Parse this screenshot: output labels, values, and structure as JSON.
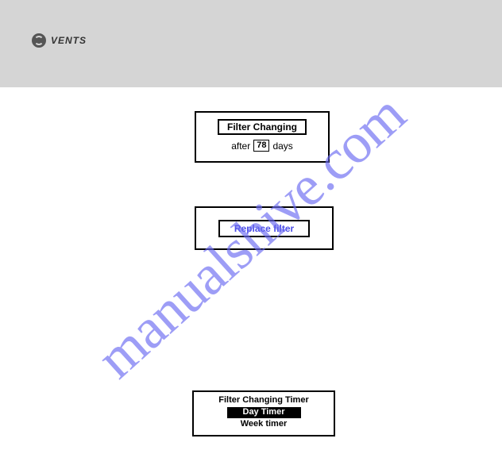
{
  "header": {
    "logo_text": "VENTS"
  },
  "panel1": {
    "button_label": "Filter Changing",
    "after_prefix": "after",
    "days_value": "78",
    "days_suffix": "days"
  },
  "panel2": {
    "button_label": "Replace filter"
  },
  "panel3": {
    "line1": "Filter Changing Timer",
    "selected": "Day Timer",
    "line3": "Week timer"
  },
  "watermark": "manualshive.com"
}
